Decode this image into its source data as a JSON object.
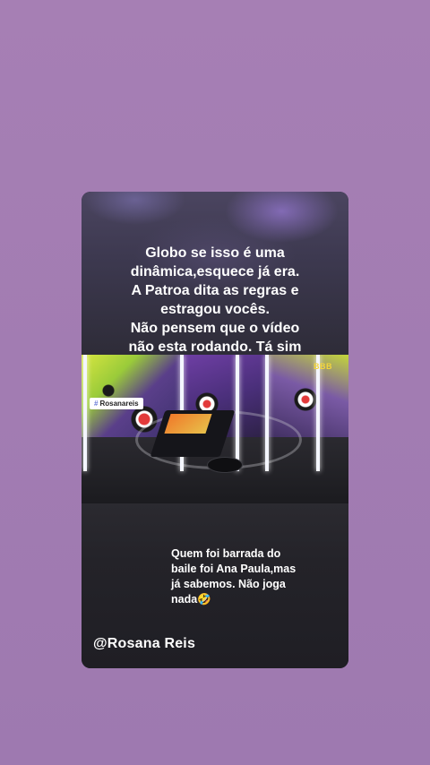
{
  "story": {
    "top_text_lines": [
      "Globo se isso é uma",
      "dinâmica,esquece já era.",
      "A Patroa dita as regras e",
      "estragou vocês.",
      "Não pensem que o vídeo",
      "não esta rodando. Tá sim"
    ],
    "video": {
      "hashtag_label": "Rosanareis",
      "hashtag_icon": "hash-icon",
      "logo_text": "BBB"
    },
    "bottom_caption_lines": [
      "Quem foi barrada do",
      "baile foi Ana Paula,mas",
      "já sabemos. Não joga",
      "nada🤣"
    ],
    "credit": "@Rosana Reis"
  },
  "colors": {
    "background": "#a67fb4",
    "card": "#1e1d23",
    "text": "#ffffff",
    "logo": "#f3d63a"
  }
}
